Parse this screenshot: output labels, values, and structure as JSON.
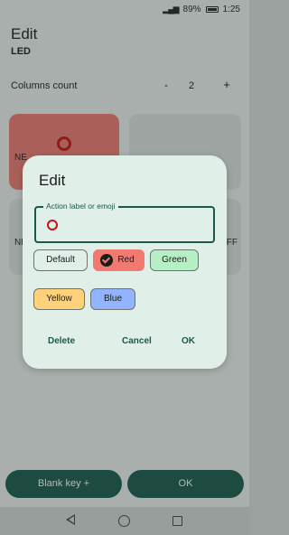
{
  "status": {
    "battery": "89%",
    "time": "1:25"
  },
  "screen": {
    "title": "Edit",
    "subtitle": "LED",
    "columns": {
      "label": "Columns count",
      "minus": "-",
      "value": "2",
      "plus": "+"
    },
    "keys": [
      {
        "label": "NE",
        "color": "#f07a70"
      },
      {
        "label": "",
        "color": "#dde3e0"
      },
      {
        "label": "NI",
        "color": "#dde3e0"
      },
      {
        "label": "FF",
        "color": "#dde3e0"
      }
    ],
    "bottom": {
      "blank_key": "Blank key +",
      "ok": "OK"
    }
  },
  "dialog": {
    "title": "Edit",
    "field": {
      "label": "Action label or emoji",
      "value_icon": "red-circle-icon"
    },
    "colors": [
      {
        "label": "Default",
        "color": "#e1efe9"
      },
      {
        "label": "Red",
        "color": "#f07a70",
        "selected": true
      },
      {
        "label": "Green",
        "color": "#b7f0c4"
      },
      {
        "label": "Yellow",
        "color": "#ffd27a"
      },
      {
        "label": "Blue",
        "color": "#92b4ff"
      }
    ],
    "actions": {
      "delete": "Delete",
      "cancel": "Cancel",
      "ok": "OK"
    }
  },
  "colors": {
    "accent": "#17594a",
    "emoji_red": "#c41212"
  }
}
